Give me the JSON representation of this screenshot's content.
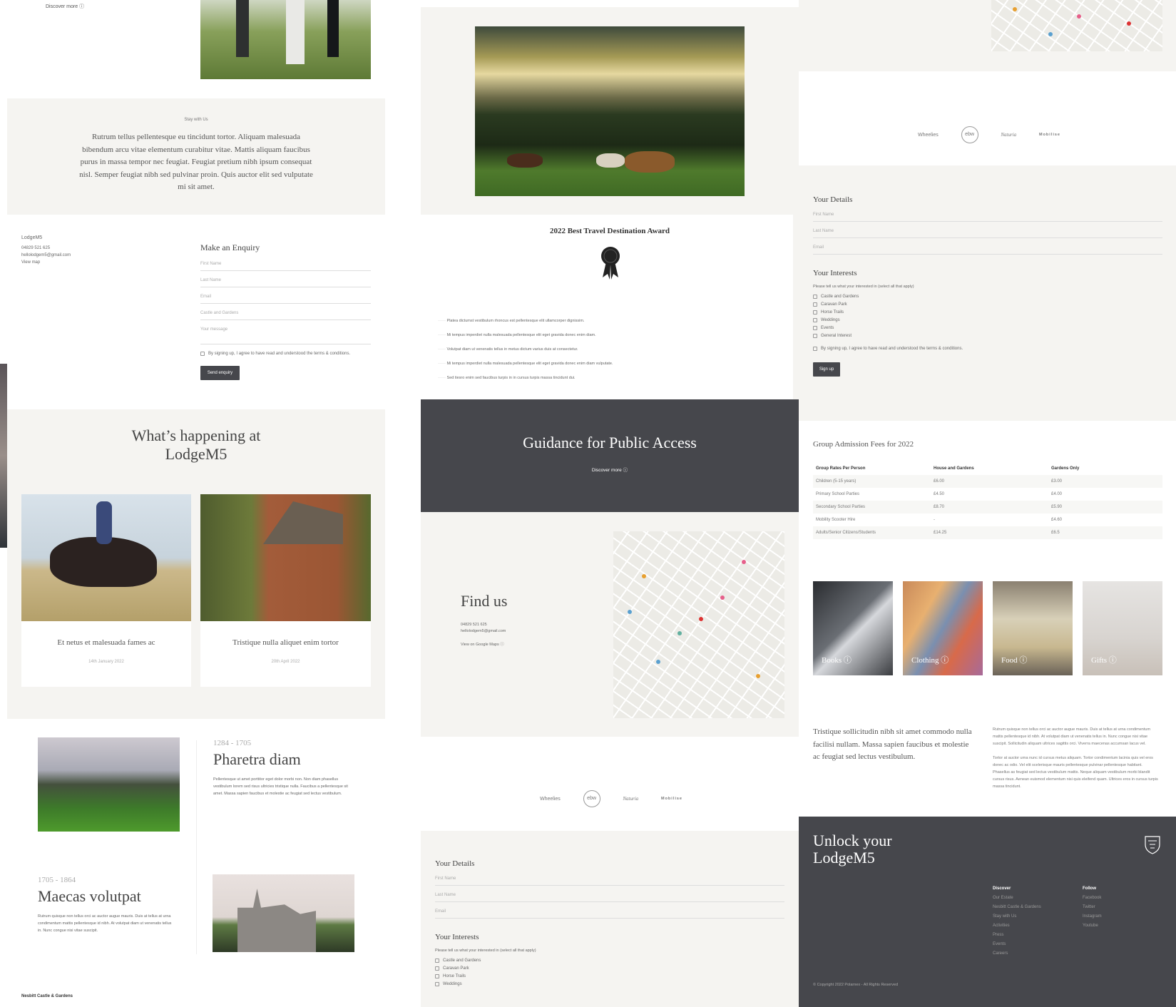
{
  "col1": {
    "discover_more": "Discover more",
    "stay": {
      "label": "Stay with Us",
      "text": "Rutrum tellus pellentesque eu tincidunt tortor. Aliquam malesuada bibendum arcu vitae elementum curabitur vitae. Mattis aliquam faucibus purus in massa tempor nec feugiat. Feugiat pretium nibh ipsum consequat nisl. Semper feugiat nibh sed pulvinar proin. Quis auctor elit sed vulputate mi sit amet."
    },
    "contact": {
      "name": "LodgeM5",
      "phone": "04829 521 625",
      "email": "hellolodgem5@gmail.com",
      "map": "View map"
    },
    "enquiry": {
      "title": "Make an Enquiry",
      "fields": [
        "First Name",
        "Last Name",
        "Email",
        "Castle and Gardens",
        "Your message"
      ],
      "terms": "By signing up, I agree to have read and understood the terms & conditions.",
      "button": "Send enquiry"
    },
    "happening": {
      "title": "What’s happening at LodgeM5",
      "cards": [
        {
          "title": "Et netus et malesuada fames ac",
          "date": "14th January 2022"
        },
        {
          "title": "Tristique nulla aliquet enim tortor",
          "date": "20th April 2022"
        }
      ]
    },
    "timeline": [
      {
        "dates": "1284 - 1705",
        "title": "Pharetra diam",
        "text": "Pellentesque ut amet porttitor eget dolor morbi non. Non diam phasellus vestibulum lorem sed risus ultricies tristique nulla. Faucibus a pellentesque sit amet. Massa sapien faucibus et molestie ac feugiat sed lectus vestibulum."
      },
      {
        "dates": "1705 - 1864",
        "title": "Maecas volutpat",
        "text": "Rutrum quisque non tellus orci ac auctor augue mauris. Duis at tellus at urna condimentum mattis pellentesque id nibh. At volutpat diam ut venenatis tellus in. Nunc congue nisi vitae suscipit."
      }
    ],
    "footer_name": "Nesbitt Castle & Gardens"
  },
  "col2": {
    "award": {
      "title": "2022 Best Travel Destination Award",
      "items": [
        "Platea dictumst vestibulum rhoncus est pellentesque elit ullamcorper dignissim.",
        "Mi tempus imperdiet nulla malesuada pellentesque elit eget gravida donec enim diam.",
        "Volutpat diam ut venenatis tellus in metus dictum varius duis at consectetur.",
        "Mi tempus imperdiet nulla malesuada pellentesque elit eget gravida donec enim diam vulputate.",
        "Sed tiesro enim sed faucibus turpis in in cursus turpis massa tincidunt dui."
      ]
    },
    "guidance": {
      "title": "Guidance for Public Access",
      "link": "Discover more"
    },
    "find": {
      "title": "Find us",
      "phone": "04829 521 625",
      "email": "hellolodgem5@gmail.com",
      "link": "View on Google Maps"
    },
    "logos": [
      "Wheelies",
      "ebw",
      "Naturia",
      "Mobilise"
    ],
    "details": {
      "title": "Your Details",
      "fields": [
        "First Name",
        "Last Name",
        "Email"
      ]
    },
    "interests": {
      "title": "Your Interests",
      "prompt": "Please tell us what your interested in (select all that apply)",
      "options": [
        "Castle and Gardens",
        "Caravan Park",
        "Horse Trails",
        "Weddings"
      ]
    }
  },
  "col3": {
    "logos": [
      "Wheelies",
      "ebw",
      "Naturia",
      "Mobilise"
    ],
    "details": {
      "title": "Your Details",
      "fields": [
        "First Name",
        "Last Name",
        "Email"
      ]
    },
    "interests": {
      "title": "Your Interests",
      "prompt": "Please tell us what your interested in (select all that apply)",
      "options": [
        "Castle and Gardens",
        "Caravan Park",
        "Horse Trails",
        "Weddings",
        "Events",
        "General Interest"
      ],
      "terms": "By signing up, I agree to have read and understood the terms & conditions.",
      "button": "Sign up"
    },
    "fees": {
      "title": "Group Admission Fees for 2022",
      "headers": [
        "Group Rates Per Person",
        "House and Gardens",
        "Gardens Only"
      ],
      "rows": [
        [
          "Children (5-15 years)",
          "£6.00",
          "£3.00"
        ],
        [
          "Primary School Parties",
          "£4.50",
          "£4.00"
        ],
        [
          "Secondary School Parties",
          "£8.70",
          "£5.90"
        ],
        [
          "Mobility Scooter Hire",
          "-",
          "£4.60"
        ],
        [
          "Adults/Senior Citizens/Students",
          "£14.25",
          "£6.5"
        ]
      ]
    },
    "tiles": [
      "Books",
      "Clothing",
      "Food",
      "Gifts"
    ],
    "intro": "Tristique sollicitudin nibh sit amet commodo nulla facilisi nullam. Massa sapien faucibus et molestie ac feugiat sed lectus vestibulum.",
    "body": [
      "Rutrum quisque non tellus orci ac auctor augue mauris. Duis at tellus at urna condimentum mattis pellentesque id nibh. At volutpat diam ut venenatis tellus in. Nunc congue nisi vitae suscipit. Sollicitudin aliquam ultrices sagittis orci. Viverra maecenas accumsan lacus vel.",
      "Tortor at auctor urna nunc id cursus metus aliquam. Tortor condimentum lacinia quis vel eros donec ac odio. Vel elit scelerisque mauris pellentesque pulvinar pellentesque habitant. Phasellus as feugiat sed lectus vestibulum mattis. Neque aliquam vestibulum morbi blandit cursus risus. Aenean euismod elementum nisi quis eleifend quam. Ultrices eros in cursus turpis massa tincidunt."
    ],
    "footer": {
      "title": "Unlock your LodgeM5",
      "discover": {
        "heading": "Discover",
        "items": [
          "Our Estate",
          "Nesbitt Castle & Gardens",
          "Stay with Us",
          "Activities",
          "Press",
          "Events",
          "Careers"
        ]
      },
      "follow": {
        "heading": "Follow",
        "items": [
          "Facebook",
          "Twitter",
          "Instagram",
          "Youtube"
        ]
      },
      "copyright": "© Copyright 2022 Polarnex - All Rights Reserved"
    }
  },
  "colors": {
    "dark": "#46474c",
    "panel": "#f5f4f1"
  }
}
